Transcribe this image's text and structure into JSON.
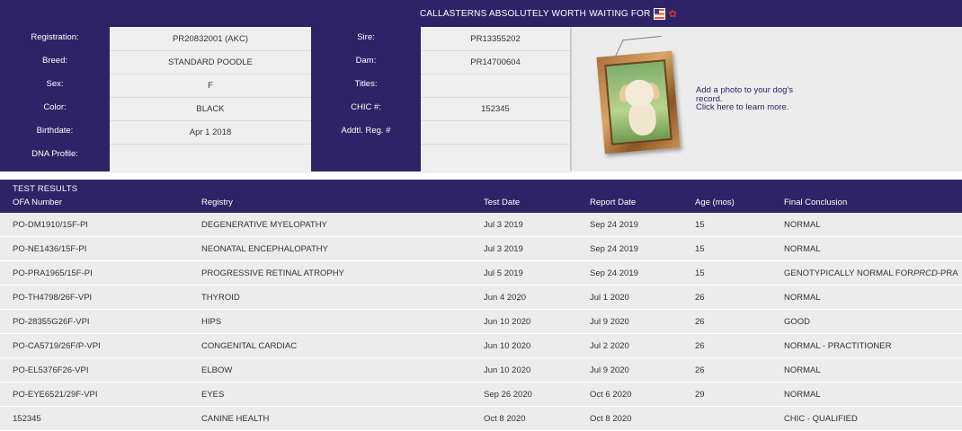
{
  "header": {
    "title": "CALLASTERNS ABSOLUTELY WORTH WAITING FOR"
  },
  "info": {
    "left_fields": [
      {
        "label": "Registration:",
        "value": "PR20832001 (AKC)"
      },
      {
        "label": "Breed:",
        "value": "STANDARD POODLE"
      },
      {
        "label": "Sex:",
        "value": "F"
      },
      {
        "label": "Color:",
        "value": "BLACK"
      },
      {
        "label": "Birthdate:",
        "value": "Apr 1 2018"
      },
      {
        "label": "DNA Profile:",
        "value": ""
      }
    ],
    "right_fields": [
      {
        "label": "Sire:",
        "value": "PR13355202"
      },
      {
        "label": "Dam:",
        "value": "PR14700604"
      },
      {
        "label": "Titles:",
        "value": ""
      },
      {
        "label": "CHIC #:",
        "value": "152345"
      },
      {
        "label": "Addtl. Reg. #",
        "value": ""
      },
      {
        "label": "",
        "value": ""
      }
    ],
    "photo": {
      "line1": "Add a photo to your dog's",
      "line2": "record.",
      "line3": "Click here to learn more."
    }
  },
  "results": {
    "section_title": "TEST RESULTS",
    "columns": [
      "OFA Number",
      "Registry",
      "Test Date",
      "Report Date",
      "Age (mos)",
      "Final Conclusion"
    ],
    "rows": [
      [
        "PO-DM1910/15F-PI",
        "DEGENERATIVE MYELOPATHY",
        "Jul 3 2019",
        "Sep 24 2019",
        "15",
        "NORMAL"
      ],
      [
        "PO-NE1436/15F-PI",
        "NEONATAL ENCEPHALOPATHY",
        "Jul 3 2019",
        "Sep 24 2019",
        "15",
        "NORMAL"
      ],
      [
        "PO-PRA1965/15F-PI",
        "PROGRESSIVE RETINAL ATROPHY",
        "Jul 5 2019",
        "Sep 24 2019",
        "15",
        "GENOTYPICALLY NORMAL FOR PRCD-PRA"
      ],
      [
        "PO-TH4798/26F-VPI",
        "THYROID",
        "Jun 4 2020",
        "Jul 1 2020",
        "26",
        "NORMAL"
      ],
      [
        "PO-28355G26F-VPI",
        "HIPS",
        "Jun 10 2020",
        "Jul 9 2020",
        "26",
        "GOOD"
      ],
      [
        "PO-CA5719/26F/P-VPI",
        "CONGENITAL CARDIAC",
        "Jun 10 2020",
        "Jul 2 2020",
        "26",
        "NORMAL - PRACTITIONER"
      ],
      [
        "PO-EL5376F26-VPI",
        "ELBOW",
        "Jun 10 2020",
        "Jul 9 2020",
        "26",
        "NORMAL"
      ],
      [
        "PO-EYE6521/29F-VPI",
        "EYES",
        "Sep 26 2020",
        "Oct 6 2020",
        "29",
        "NORMAL"
      ],
      [
        "152345",
        "CANINE HEALTH",
        "Oct 8 2020",
        "Oct 8 2020",
        "",
        "CHIC - QUALIFIED"
      ]
    ]
  }
}
